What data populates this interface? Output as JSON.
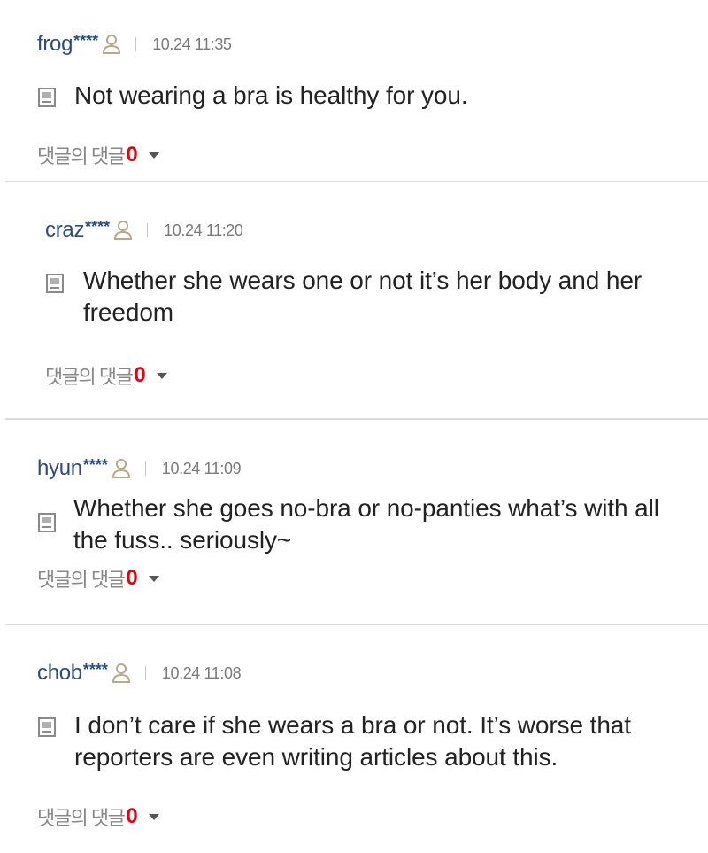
{
  "comments": [
    {
      "username": "frog",
      "masked": "****",
      "timestamp": "10.24 11:35",
      "text": "Not wearing a bra is healthy for you.",
      "replies_label": "댓글의 댓글",
      "replies_count": "0"
    },
    {
      "username": "craz",
      "masked": "****",
      "timestamp": "10.24 11:20",
      "text": "Whether she wears one or not it’s her body and her freedom",
      "replies_label": "댓글의 댓글",
      "replies_count": "0"
    },
    {
      "username": "hyun",
      "masked": "****",
      "timestamp": "10.24 11:09",
      "text": "Whether she goes no-bra or no-panties what’s with all the fuss.. seriously~",
      "replies_label": "댓글의 댓글",
      "replies_count": "0"
    },
    {
      "username": "chob",
      "masked": "****",
      "timestamp": "10.24 11:08",
      "text": "I don’t care if she wears a bra or not. It’s worse that reporters are even writing articles about this.",
      "replies_label": "댓글의 댓글",
      "replies_count": "0"
    }
  ],
  "icons": {
    "user": "user-icon",
    "comment": "comment-icon",
    "expand": "caret-down-icon"
  },
  "colors": {
    "username": "#2b4c82",
    "reply_count": "#e8000b",
    "timestamp": "#7a7a7a",
    "body_text": "#222222"
  }
}
